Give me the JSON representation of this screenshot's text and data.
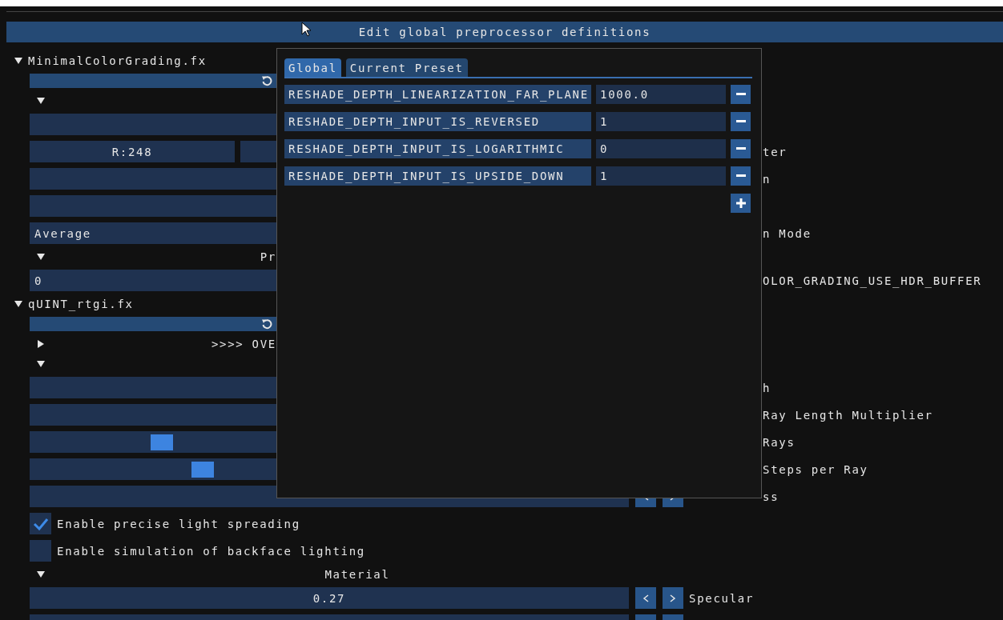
{
  "title_bar": {
    "title": "Edit global preprocessor definitions"
  },
  "effects": [
    {
      "name": "MinimalColorGrading.fx",
      "expanded": true,
      "rows": [
        {
          "kind": "reset"
        },
        {
          "kind": "category",
          "expanded": true
        },
        {
          "kind": "slider"
        },
        {
          "kind": "color",
          "value": "R:248",
          "label": "ter",
          "clipped": true
        },
        {
          "kind": "slider",
          "label": "n",
          "clipped": true
        },
        {
          "kind": "slider"
        },
        {
          "kind": "combo",
          "value": "Average",
          "label": "n Mode",
          "clipped": true
        },
        {
          "kind": "category",
          "expanded": true,
          "label": "Pr",
          "clipped": true
        },
        {
          "kind": "input",
          "value": "0",
          "label": "OLOR_GRADING_USE_HDR_BUFFER",
          "clipped": true
        }
      ]
    },
    {
      "name": "qUINT_rtgi.fx",
      "expanded": true,
      "rows": [
        {
          "kind": "reset"
        },
        {
          "kind": "category",
          "expanded": false,
          "label": ">>>> OVE",
          "clipped": true
        },
        {
          "kind": "category",
          "expanded": true
        },
        {
          "kind": "slider",
          "label": "h",
          "clipped": true
        },
        {
          "kind": "slider",
          "label": "Ray Length Multiplier",
          "clipped": true
        },
        {
          "kind": "slider",
          "level": 0.21,
          "label": "Rays",
          "clipped": true
        },
        {
          "kind": "slider",
          "level": 0.28,
          "label": "Steps per Ray",
          "clipped": true
        },
        {
          "kind": "slider",
          "label": "ss",
          "clipped": true
        },
        {
          "kind": "checkbox",
          "checked": true,
          "label": "Enable precise light spreading"
        },
        {
          "kind": "checkbox",
          "checked": false,
          "label": "Enable simulation of backface lighting"
        },
        {
          "kind": "category",
          "expanded": true,
          "label": "Material"
        },
        {
          "kind": "slider",
          "reading": "0.27",
          "label": "Specular"
        },
        {
          "kind": "slider"
        }
      ]
    }
  ],
  "popup": {
    "tabs": [
      {
        "label": "Global",
        "selected": true
      },
      {
        "label": "Current Preset",
        "selected": false
      }
    ],
    "definitions": [
      {
        "name": "RESHADE_DEPTH_LINEARIZATION_FAR_PLANE",
        "value": "1000.0"
      },
      {
        "name": "RESHADE_DEPTH_INPUT_IS_REVERSED",
        "value": "1"
      },
      {
        "name": "RESHADE_DEPTH_INPUT_IS_LOGARITHMIC",
        "value": "0"
      },
      {
        "name": "RESHADE_DEPTH_INPUT_IS_UPSIDE_DOWN",
        "value": "1"
      }
    ]
  }
}
